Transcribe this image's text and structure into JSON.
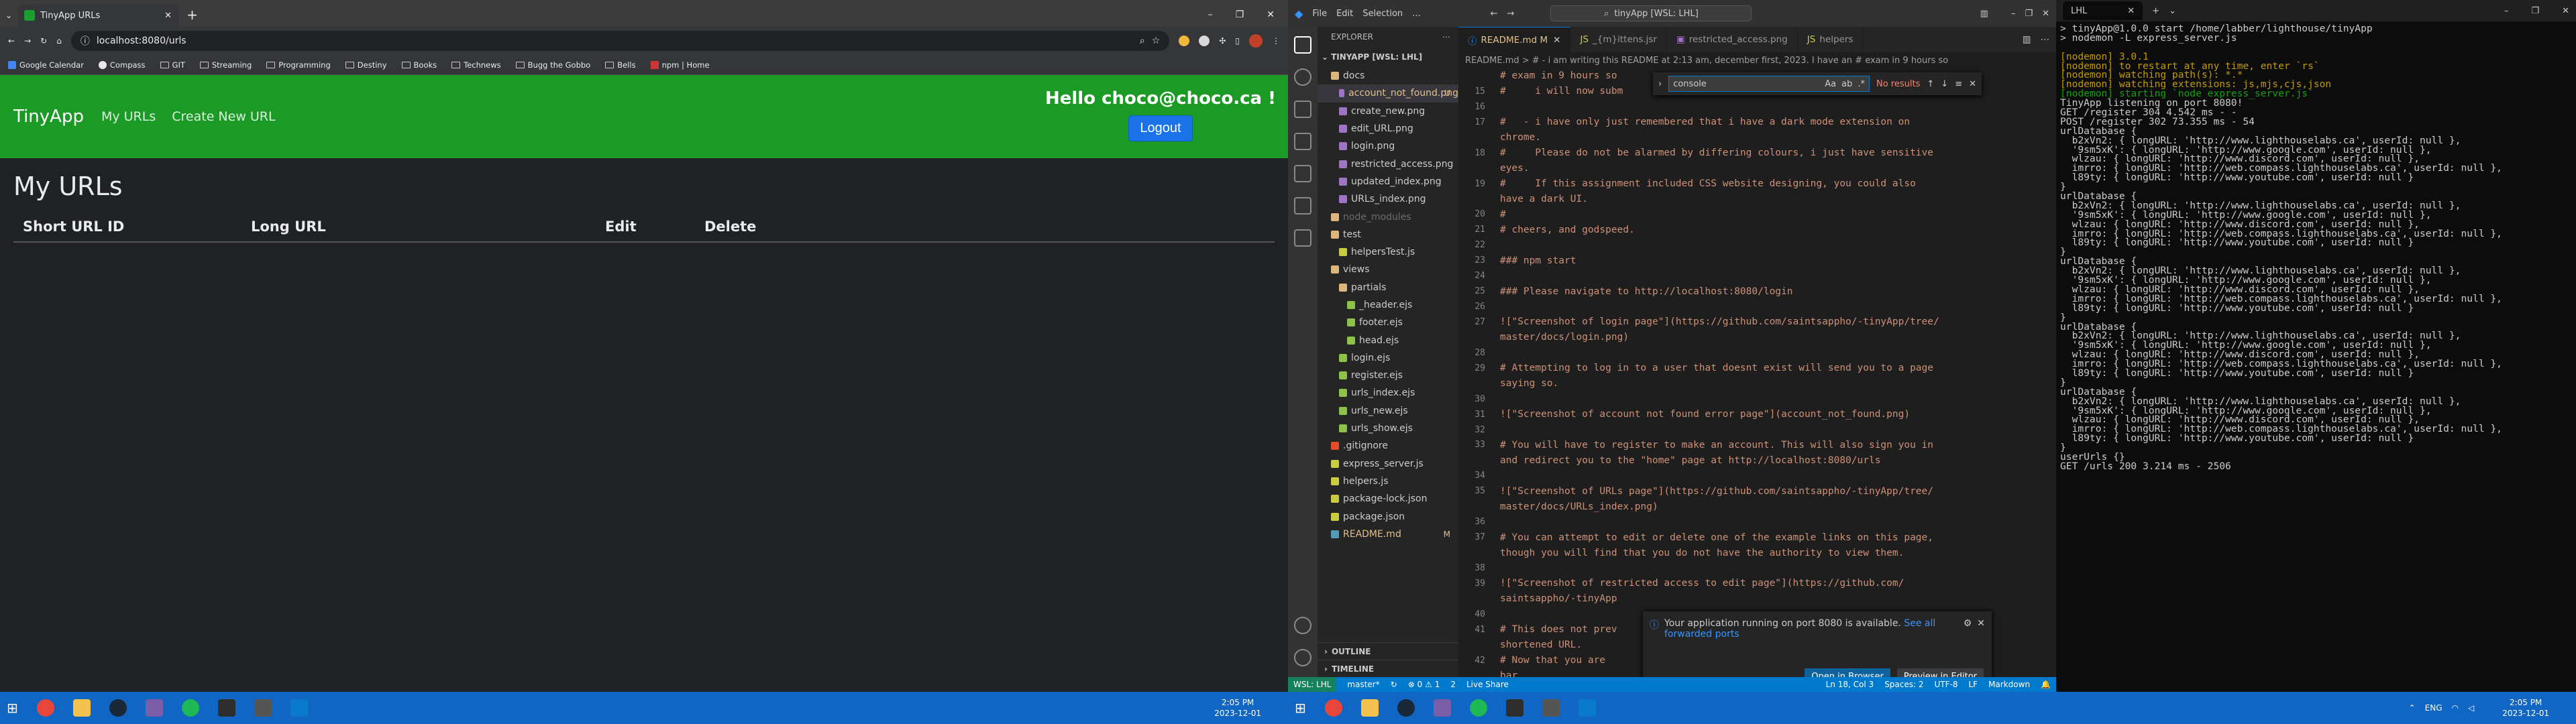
{
  "chrome": {
    "tab_title": "TinyApp URLs",
    "url": "localhost:8080/urls",
    "bookmarks": [
      "Google Calendar",
      "Compass",
      "GIT",
      "Streaming",
      "Programming",
      "Destiny",
      "Books",
      "Technews",
      "Bugg the Gobbo",
      "Bells",
      "npm | Home"
    ]
  },
  "app": {
    "brand": "TinyApp",
    "nav_my_urls": "My URLs",
    "nav_create": "Create New URL",
    "greeting": "Hello choco@choco.ca !",
    "logout": "Logout",
    "page_title": "My URLs",
    "columns": [
      "Short URL ID",
      "Long URL",
      "Edit",
      "Delete"
    ]
  },
  "taskbar": {
    "left_time": "2:05 PM",
    "left_date": "2023-12-01",
    "right_time": "2:05 PM",
    "right_date": "2023-12-01",
    "lang": "ENG"
  },
  "vscode": {
    "menu": [
      "File",
      "Edit",
      "Selection",
      "..."
    ],
    "search": "tinyApp [WSL: LHL]",
    "explorer_title": "EXPLORER",
    "workspace": "TINYAPP [WSL: LHL]",
    "tree": [
      {
        "label": "docs",
        "indent": 1,
        "kind": "folder-open",
        "badge": "",
        "cls": ""
      },
      {
        "label": "account_not_found.png",
        "indent": 2,
        "kind": "img",
        "badge": "U",
        "cls": "mod sel"
      },
      {
        "label": "create_new.png",
        "indent": 2,
        "kind": "img",
        "badge": "",
        "cls": ""
      },
      {
        "label": "edit_URL.png",
        "indent": 2,
        "kind": "img",
        "badge": "",
        "cls": ""
      },
      {
        "label": "login.png",
        "indent": 2,
        "kind": "img",
        "badge": "",
        "cls": ""
      },
      {
        "label": "restricted_access.png",
        "indent": 2,
        "kind": "img",
        "badge": "",
        "cls": ""
      },
      {
        "label": "updated_index.png",
        "indent": 2,
        "kind": "img",
        "badge": "",
        "cls": ""
      },
      {
        "label": "URLs_index.png",
        "indent": 2,
        "kind": "img",
        "badge": "",
        "cls": ""
      },
      {
        "label": "node_modules",
        "indent": 1,
        "kind": "folder",
        "badge": "",
        "cls": "dim"
      },
      {
        "label": "test",
        "indent": 1,
        "kind": "folder-open",
        "badge": "",
        "cls": ""
      },
      {
        "label": "helpersTest.js",
        "indent": 2,
        "kind": "js",
        "badge": "",
        "cls": ""
      },
      {
        "label": "views",
        "indent": 1,
        "kind": "folder-open",
        "badge": "",
        "cls": ""
      },
      {
        "label": "partials",
        "indent": 2,
        "kind": "folder-open",
        "badge": "",
        "cls": ""
      },
      {
        "label": "_header.ejs",
        "indent": 3,
        "kind": "ejs",
        "badge": "",
        "cls": ""
      },
      {
        "label": "footer.ejs",
        "indent": 3,
        "kind": "ejs",
        "badge": "",
        "cls": ""
      },
      {
        "label": "head.ejs",
        "indent": 3,
        "kind": "ejs",
        "badge": "",
        "cls": ""
      },
      {
        "label": "login.ejs",
        "indent": 2,
        "kind": "ejs",
        "badge": "",
        "cls": ""
      },
      {
        "label": "register.ejs",
        "indent": 2,
        "kind": "ejs",
        "badge": "",
        "cls": ""
      },
      {
        "label": "urls_index.ejs",
        "indent": 2,
        "kind": "ejs",
        "badge": "",
        "cls": ""
      },
      {
        "label": "urls_new.ejs",
        "indent": 2,
        "kind": "ejs",
        "badge": "",
        "cls": ""
      },
      {
        "label": "urls_show.ejs",
        "indent": 2,
        "kind": "ejs",
        "badge": "",
        "cls": ""
      },
      {
        "label": ".gitignore",
        "indent": 1,
        "kind": "git",
        "badge": "",
        "cls": ""
      },
      {
        "label": "express_server.js",
        "indent": 1,
        "kind": "js",
        "badge": "",
        "cls": ""
      },
      {
        "label": "helpers.js",
        "indent": 1,
        "kind": "js",
        "badge": "",
        "cls": ""
      },
      {
        "label": "package-lock.json",
        "indent": 1,
        "kind": "json",
        "badge": "",
        "cls": ""
      },
      {
        "label": "package.json",
        "indent": 1,
        "kind": "json",
        "badge": "",
        "cls": ""
      },
      {
        "label": "README.md",
        "indent": 1,
        "kind": "md",
        "badge": "M",
        "cls": "mod"
      }
    ],
    "outline": "OUTLINE",
    "timeline": "TIMELINE",
    "tabs": [
      {
        "label": "README.md M",
        "active": true
      },
      {
        "label": "_{m}ittens.jsr",
        "active": false
      },
      {
        "label": "restricted_access.png",
        "active": false
      },
      {
        "label": "helpers",
        "active": false
      }
    ],
    "breadcrumb": "README.md > # - i am writing this README at 2:13 am, december first, 2023. I have an # exam in 9 hours so",
    "find_value": "console",
    "find_result": "No results",
    "lines": [
      {
        "n": "",
        "t": "# exam in 9 hours so"
      },
      {
        "n": "15",
        "t": "#     i will now subm"
      },
      {
        "n": "16",
        "t": ""
      },
      {
        "n": "17",
        "t": "#   - i have only just remembered that i have a dark mode extension on"
      },
      {
        "n": "",
        "t": "chrome."
      },
      {
        "n": "18",
        "t": "#     Please do not be alarmed by differing colours, i just have sensitive"
      },
      {
        "n": "",
        "t": "eyes."
      },
      {
        "n": "19",
        "t": "#     If this assignment included CSS website designing, you could also"
      },
      {
        "n": "",
        "t": "have a dark UI."
      },
      {
        "n": "20",
        "t": "#"
      },
      {
        "n": "21",
        "t": "# cheers, and godspeed."
      },
      {
        "n": "22",
        "t": ""
      },
      {
        "n": "23",
        "t": "### npm start"
      },
      {
        "n": "24",
        "t": ""
      },
      {
        "n": "25",
        "t": "### Please navigate to http://localhost:8080/login"
      },
      {
        "n": "26",
        "t": ""
      },
      {
        "n": "27",
        "t": "![\"Screenshot of login page\"](https://github.com/saintsappho/-tinyApp/tree/"
      },
      {
        "n": "",
        "t": "master/docs/login.png)"
      },
      {
        "n": "28",
        "t": ""
      },
      {
        "n": "29",
        "t": "# Attempting to log in to a user that doesnt exist will send you to a page"
      },
      {
        "n": "",
        "t": "saying so."
      },
      {
        "n": "30",
        "t": ""
      },
      {
        "n": "31",
        "t": "![\"Screenshot of account not found error page\"](account_not_found.png)"
      },
      {
        "n": "32",
        "t": ""
      },
      {
        "n": "33",
        "t": "# You will have to register to make an account. This will also sign you in"
      },
      {
        "n": "",
        "t": "and redirect you to the \"home\" page at http://localhost:8080/urls"
      },
      {
        "n": "34",
        "t": ""
      },
      {
        "n": "35",
        "t": "![\"Screenshot of URLs page\"](https://github.com/saintsappho/-tinyApp/tree/"
      },
      {
        "n": "",
        "t": "master/docs/URLs_index.png)"
      },
      {
        "n": "36",
        "t": ""
      },
      {
        "n": "37",
        "t": "# You can attempt to edit or delete one of the example links on this page,"
      },
      {
        "n": "",
        "t": "though you will find that you do not have the authority to view them."
      },
      {
        "n": "38",
        "t": ""
      },
      {
        "n": "39",
        "t": "![\"Screenshot of restricted access to edit page\"](https://github.com/"
      },
      {
        "n": "",
        "t": "saintsappho/-tinyApp"
      },
      {
        "n": "40",
        "t": ""
      },
      {
        "n": "41",
        "t": "# This does not prev"
      },
      {
        "n": "",
        "t": "shortened URL."
      },
      {
        "n": "42",
        "t": "# Now that you are"
      },
      {
        "n": "",
        "t": "bar."
      }
    ],
    "notification": {
      "text": "Your application running on port 8080 is available.",
      "link": "See all forwarded ports",
      "btn_open": "Open in Browser",
      "btn_preview": "Preview in Editor"
    },
    "status": {
      "remote": "WSL: LHL",
      "branch": "master*",
      "problems": "⊗ 0 ⚠ 1",
      "ports": "2",
      "live": "Live Share",
      "pos": "Ln 18, Col 3",
      "spaces": "Spaces: 2",
      "enc": "UTF-8",
      "eol": "LF",
      "lang": "Markdown"
    }
  },
  "terminal": {
    "tab_title": "LHL",
    "lines": [
      {
        "c": "w",
        "t": "> tinyApp@1.0.0 start /home/labber/lighthouse/tinyApp"
      },
      {
        "c": "w",
        "t": "> nodemon -L express_server.js"
      },
      {
        "c": "w",
        "t": ""
      },
      {
        "c": "y",
        "t": "[nodemon] 3.0.1"
      },
      {
        "c": "y",
        "t": "[nodemon] to restart at any time, enter `rs`"
      },
      {
        "c": "y",
        "t": "[nodemon] watching path(s): *.*"
      },
      {
        "c": "y",
        "t": "[nodemon] watching extensions: js,mjs,cjs,json"
      },
      {
        "c": "g",
        "t": "[nodemon] starting `node express_server.js`"
      },
      {
        "c": "w",
        "t": "TinyApp listening on port 8080!"
      },
      {
        "c": "w",
        "t": "GET /register 304 4.542 ms - -"
      },
      {
        "c": "w",
        "t": "POST /register 302 73.355 ms - 54"
      },
      {
        "c": "w",
        "t": "urlDatabase {"
      },
      {
        "c": "w",
        "t": "  b2xVn2: { longURL: 'http://www.lighthouselabs.ca', userId: null },"
      },
      {
        "c": "w",
        "t": "  '9sm5xK': { longURL: 'http://www.google.com', userId: null },"
      },
      {
        "c": "w",
        "t": "  wlzau: { longURL: 'http://www.discord.com', userId: null },"
      },
      {
        "c": "w",
        "t": "  imrro: { longURL: 'http://web.compass.lighthouselabs.ca', userId: null },"
      },
      {
        "c": "w",
        "t": "  l89ty: { longURL: 'http://www.youtube.com', userId: null }"
      },
      {
        "c": "w",
        "t": "}"
      },
      {
        "c": "w",
        "t": "urlDatabase {"
      },
      {
        "c": "w",
        "t": "  b2xVn2: { longURL: 'http://www.lighthouselabs.ca', userId: null },"
      },
      {
        "c": "w",
        "t": "  '9sm5xK': { longURL: 'http://www.google.com', userId: null },"
      },
      {
        "c": "w",
        "t": "  wlzau: { longURL: 'http://www.discord.com', userId: null },"
      },
      {
        "c": "w",
        "t": "  imrro: { longURL: 'http://web.compass.lighthouselabs.ca', userId: null },"
      },
      {
        "c": "w",
        "t": "  l89ty: { longURL: 'http://www.youtube.com', userId: null }"
      },
      {
        "c": "w",
        "t": "}"
      },
      {
        "c": "w",
        "t": "urlDatabase {"
      },
      {
        "c": "w",
        "t": "  b2xVn2: { longURL: 'http://www.lighthouselabs.ca', userId: null },"
      },
      {
        "c": "w",
        "t": "  '9sm5xK': { longURL: 'http://www.google.com', userId: null },"
      },
      {
        "c": "w",
        "t": "  wlzau: { longURL: 'http://www.discord.com', userId: null },"
      },
      {
        "c": "w",
        "t": "  imrro: { longURL: 'http://web.compass.lighthouselabs.ca', userId: null },"
      },
      {
        "c": "w",
        "t": "  l89ty: { longURL: 'http://www.youtube.com', userId: null }"
      },
      {
        "c": "w",
        "t": "}"
      },
      {
        "c": "w",
        "t": "urlDatabase {"
      },
      {
        "c": "w",
        "t": "  b2xVn2: { longURL: 'http://www.lighthouselabs.ca', userId: null },"
      },
      {
        "c": "w",
        "t": "  '9sm5xK': { longURL: 'http://www.google.com', userId: null },"
      },
      {
        "c": "w",
        "t": "  wlzau: { longURL: 'http://www.discord.com', userId: null },"
      },
      {
        "c": "w",
        "t": "  imrro: { longURL: 'http://web.compass.lighthouselabs.ca', userId: null },"
      },
      {
        "c": "w",
        "t": "  l89ty: { longURL: 'http://www.youtube.com', userId: null }"
      },
      {
        "c": "w",
        "t": "}"
      },
      {
        "c": "w",
        "t": "urlDatabase {"
      },
      {
        "c": "w",
        "t": "  b2xVn2: { longURL: 'http://www.lighthouselabs.ca', userId: null },"
      },
      {
        "c": "w",
        "t": "  '9sm5xK': { longURL: 'http://www.google.com', userId: null },"
      },
      {
        "c": "w",
        "t": "  wlzau: { longURL: 'http://www.discord.com', userId: null },"
      },
      {
        "c": "w",
        "t": "  imrro: { longURL: 'http://web.compass.lighthouselabs.ca', userId: null },"
      },
      {
        "c": "w",
        "t": "  l89ty: { longURL: 'http://www.youtube.com', userId: null }"
      },
      {
        "c": "w",
        "t": "}"
      },
      {
        "c": "w",
        "t": "userUrls {}"
      },
      {
        "c": "w",
        "t": "GET /urls 200 3.214 ms - 2506"
      }
    ]
  }
}
